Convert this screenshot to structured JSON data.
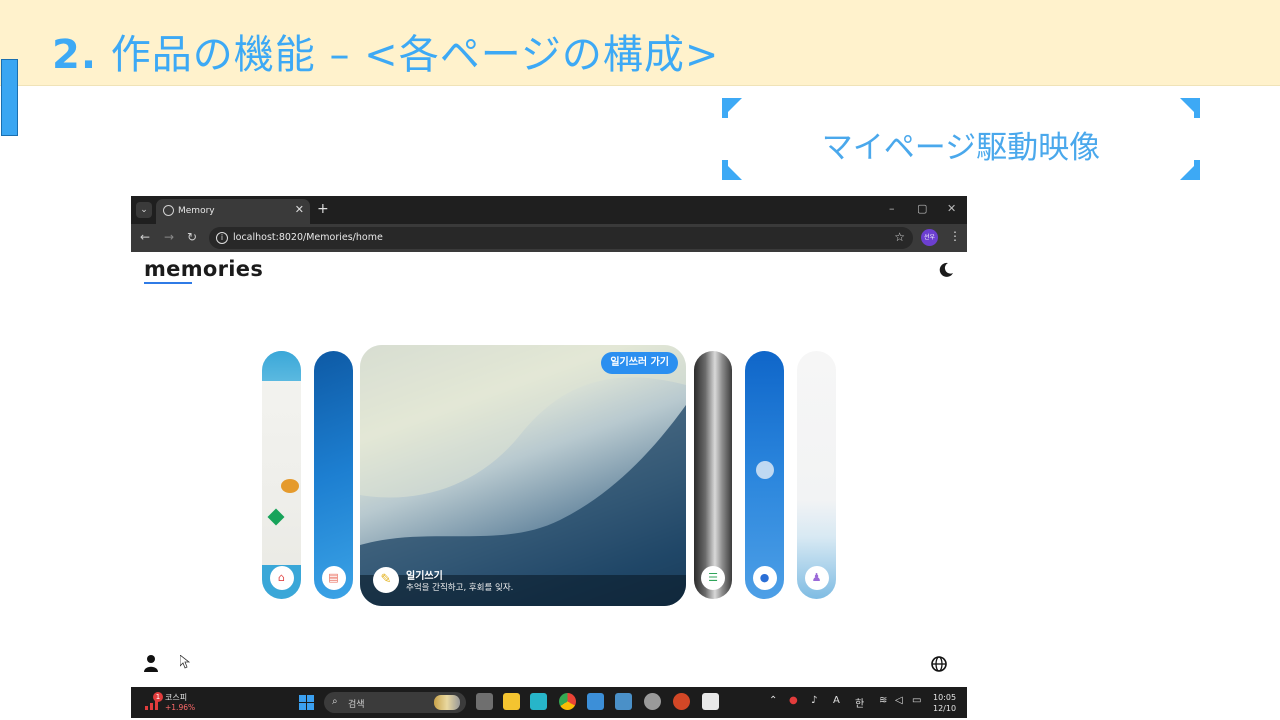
{
  "slide": {
    "title_number": "2.",
    "title_text": " 作品の機能 – <各ページの構成>",
    "caption": "マイページ駆動映像",
    "accent_color": "#3da9f5",
    "band_color": "#fff2cc"
  },
  "browser": {
    "tab_title": "Memory",
    "url": "localhost:8020/Memories/home",
    "profile_label": "선우",
    "window_controls": [
      "–",
      "▢",
      "✕"
    ]
  },
  "app": {
    "logo": "memories",
    "theme_icon": "moon-icon",
    "cards": [
      {
        "name": "home",
        "icon": "home-icon"
      },
      {
        "name": "profile-card",
        "icon": "id-card-icon"
      },
      {
        "name": "list",
        "icon": "list-icon"
      },
      {
        "name": "chat",
        "icon": "chat-icon"
      },
      {
        "name": "user",
        "icon": "person-icon"
      }
    ],
    "featured": {
      "button": "일기쓰러 가기",
      "title": "일기쓰기",
      "subtitle": "추억을 간직하고, 후회를 잊자.",
      "icon": "pencil-icon"
    }
  },
  "taskbar": {
    "stock_badge": "1",
    "stock_name": "코스피",
    "stock_change": "+1.96%",
    "search_placeholder": "검색",
    "ime_mode": "A",
    "ime_lang": "한",
    "time": "10:05",
    "date": "12/10"
  }
}
